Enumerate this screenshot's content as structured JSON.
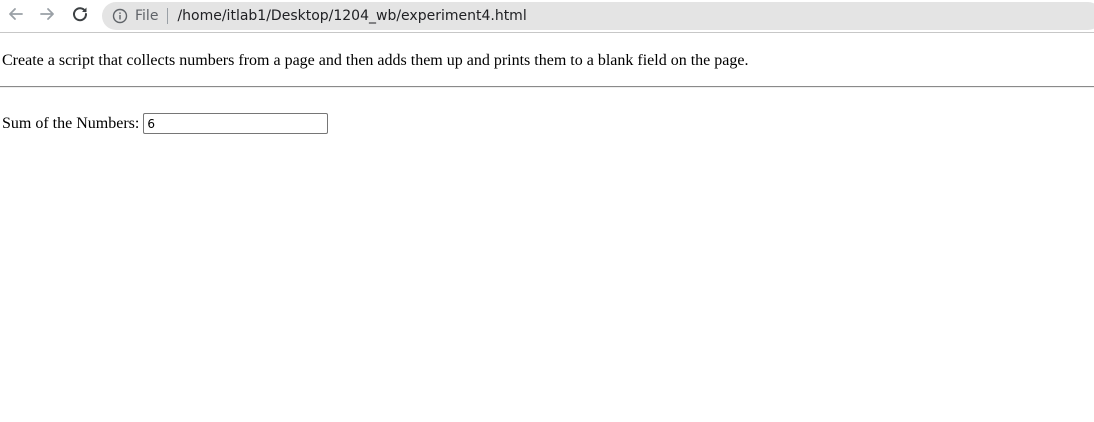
{
  "browser": {
    "scheme_label": "File",
    "url": "/home/itlab1/Desktop/1204_wb/experiment4.html",
    "icons": {
      "back": "arrow-left-icon",
      "forward": "arrow-right-icon",
      "reload": "reload-icon",
      "site_info": "info-icon"
    }
  },
  "page": {
    "description": "Create a script that collects numbers from a page and then adds them up and prints them to a blank field on the page.",
    "sum_label": "Sum of the Numbers:",
    "sum_value": "6"
  }
}
